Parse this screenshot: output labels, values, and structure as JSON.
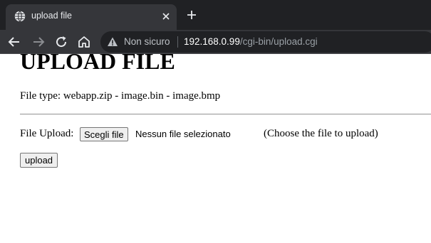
{
  "browser": {
    "tab": {
      "title": "upload file",
      "favicon_icon": "globe-icon",
      "close_icon": "close-icon"
    },
    "new_tab_icon": "plus-icon",
    "nav": {
      "back_icon": "arrow-left-icon",
      "forward_icon": "arrow-right-icon",
      "reload_icon": "reload-icon",
      "home_icon": "home-icon"
    },
    "omnibox": {
      "security_icon": "warning-icon",
      "security_text": "Non sicuro",
      "url_host": "192.168.0.99",
      "url_path": "/cgi-bin/upload.cgi"
    }
  },
  "page": {
    "title": "UPLOAD FILE",
    "file_types": "File type: webapp.zip - image.bin - image.bmp",
    "upload_row": {
      "label": "File Upload:",
      "choose_button": "Scegli file",
      "no_file_text": "Nessun file selezionato",
      "hint": "(Choose the file to upload)"
    },
    "submit_button": "upload"
  },
  "colors": {
    "tabstrip_bg": "#202124",
    "tab_bg": "#35363a",
    "omnibox_bg": "#202124",
    "url_host": "#ffffff",
    "url_path": "#9aa0a6"
  }
}
